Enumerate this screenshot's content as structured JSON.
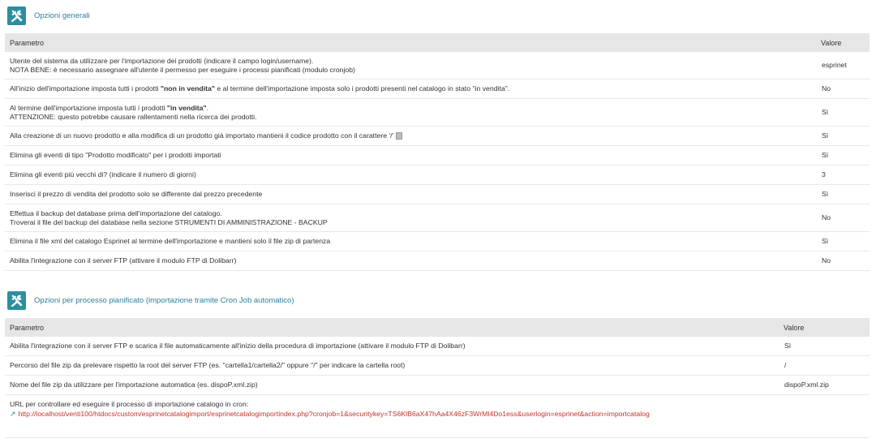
{
  "section1": {
    "title": "Opzioni generali",
    "col_param": "Parametro",
    "col_value": "Valore",
    "rows": [
      {
        "line1": "Utente del sistema da utilizzare per l'importazione dei prodotti (indicare il campo login/username).",
        "line2": "NOTA BENE: è necessario assegnare all'utente il permesso per eseguire i processi pianificati (modulo cronjob)",
        "value": "esprinet"
      },
      {
        "pre": "All'inizio dell'importazione imposta tutti i prodotti ",
        "bold": "\"non in vendita\"",
        "post": " e al termine dell'importazione imposta solo i prodotti presenti nel catalogo in stato \"in vendita\".",
        "value": "No"
      },
      {
        "pre": "Al termine dell'importazione imposta tutti i prodotti ",
        "bold": "\"in vendita\"",
        "post": ".",
        "line2": "ATTENZIONE: questo potrebbe causare rallentamenti nella ricerca dei prodotti.",
        "value": "Sì"
      },
      {
        "text": "Alla creazione di un nuovo prodotto e alla modifica di un prodotto già importato mantieni il codice prodotto con il carattere '/'",
        "value": "Sì"
      },
      {
        "text": "Elimina gli eventi di tipo \"Prodotto modificato\" per i prodotti importati",
        "value": "Sì"
      },
      {
        "text": "Elimina gli eventi più vecchi di? (indicare il numero di giorni)",
        "value": "3"
      },
      {
        "text": "Inserisci il prezzo di vendita del prodotto solo se differente dal prezzo precedente",
        "value": "Sì"
      },
      {
        "line1": "Effettua il backup del database prima dell'importazione del catalogo.",
        "line2": "Troverai il file del backup del database nella sezione STRUMENTI DI AMMINISTRAZIONE - BACKUP",
        "value": "No"
      },
      {
        "text": "Elimina il file xml del catalogo Esprinet al termine dell'importazione e mantieni solo il file zip di partenza",
        "value": "Sì"
      },
      {
        "text": "Abilita l'integrazione con il server FTP (attivare il modulo FTP di Dolibarr)",
        "value": "No"
      }
    ]
  },
  "section2": {
    "title": "Opzioni per processo pianificato (importazione tramite Cron Job automatico)",
    "col_param": "Parametro",
    "col_value": "Valore",
    "rows": [
      {
        "text": "Abilita l'integrazione con il server FTP e scarica il file automaticamente all'inizio della procedura di importazione (attivare il modulo FTP di Dolibarr)",
        "value": "Sì"
      },
      {
        "text": "Percorso del file zip da prelevare rispetto la root del server FTP (es. \"cartella1/cartella2/\" oppure \"/\" per indicare la cartella root)",
        "value": "/"
      },
      {
        "text": "Nome del file zip da utilizzare per l'importazione automatica (es. dispoP.xml.zip)",
        "value": "dispoP.xml.zip"
      }
    ],
    "cron_label": "URL per controllare ed eseguire il processo di importazione catalogo in cron:",
    "cron_url": "http://localhost/venti100/htdocs/custom/esprinetcatalogimport/esprinetcatalogimportindex.php?cronjob=1&securitykey=TS6KlB6aX47hAa4X46zF3WrMl4Do1ess&userlogin=esprinet&action=importcatalog"
  },
  "icons": {
    "section": "tools-icon",
    "link": "external-link-icon"
  },
  "colors": {
    "accent": "#2d8ea1",
    "title": "#2b7f9a",
    "url": "#c2352b",
    "header_bg": "#e6e6e6"
  }
}
